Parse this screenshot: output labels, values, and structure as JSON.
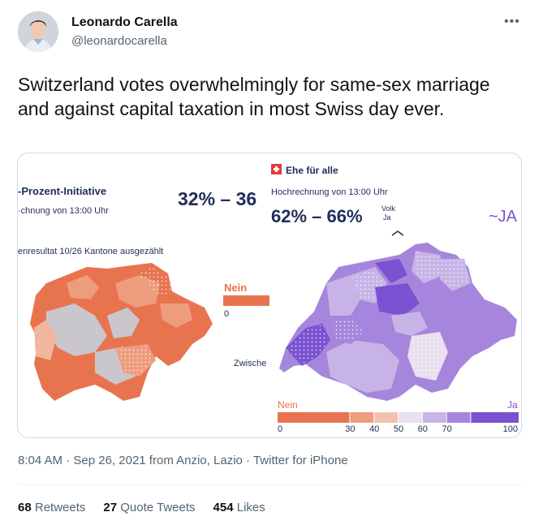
{
  "author": {
    "display_name": "Leonardo Carella",
    "handle": "@leonardocarella"
  },
  "tweet": {
    "text": "Switzerland votes overwhelmingly for same-sex marriage and against capital taxation in most Swiss day ever."
  },
  "media": {
    "left": {
      "title": "-Prozent-Initiative",
      "subtitle": "·chnung von 13:00 Uhr",
      "result": "enresultat 10/26 Kantone ausgezählt",
      "percent_range": "32% – 36"
    },
    "right": {
      "badge": "Ehe für alle",
      "subtitle": "Hochrechnung von 13:00 Uhr",
      "percent_range": "62% – 66%",
      "volk": "Volk",
      "ja_small": "Ja",
      "ja_big": "~JA"
    },
    "legend_mid": {
      "nein": "Nein",
      "zero": "0",
      "zwischen": "Zwische"
    },
    "scale": {
      "nein": "Nein",
      "ja": "Ja",
      "ticks": [
        "0",
        "30",
        "40",
        "50",
        "60",
        "70",
        "100"
      ],
      "colors": [
        "#e8744f",
        "#ee9c7e",
        "#f3c2ae",
        "#e9e0ee",
        "#c7b3e6",
        "#a686dc",
        "#7b52d1"
      ]
    }
  },
  "meta": {
    "time": "8:04 AM",
    "sep1": " · ",
    "date": "Sep 26, 2021",
    "location": " from Anzio, Lazio",
    "sep2": " · ",
    "client": "Twitter for iPhone"
  },
  "stats": {
    "retweets_count": "68",
    "retweets_label": "Retweets",
    "quotes_count": "27",
    "quotes_label": "Quote Tweets",
    "likes_count": "454",
    "likes_label": "Likes"
  }
}
